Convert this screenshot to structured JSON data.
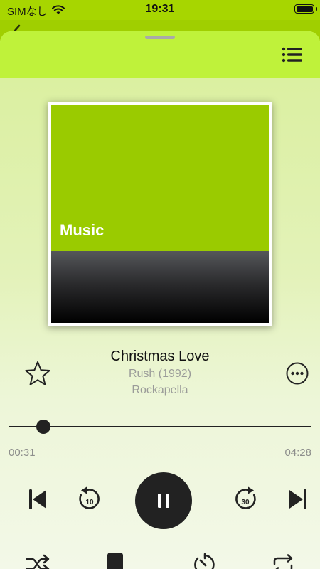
{
  "status_bar": {
    "carrier": "SIMなし",
    "time": "19:31",
    "icons": [
      "wifi-icon",
      "battery-icon"
    ]
  },
  "sheet": {
    "queue_icon": "list-icon"
  },
  "artwork": {
    "label": "Music",
    "top_color": "#9acb00"
  },
  "track": {
    "title": "Christmas Love",
    "album": "Rush (1992)",
    "artist": "Rockapella"
  },
  "progress": {
    "elapsed": "00:31",
    "total": "04:28",
    "fraction": 0.116
  },
  "controls": {
    "skip_back_seconds": "10",
    "skip_forward_seconds": "30",
    "state": "playing",
    "icons": [
      "previous-track-icon",
      "rewind-10-icon",
      "pause-icon",
      "forward-30-icon",
      "next-track-icon",
      "shuffle-icon",
      "airplay-icon",
      "timer-icon",
      "repeat-icon"
    ]
  },
  "colors": {
    "accent": "#bff23a",
    "brand_green": "#9acb00",
    "control_dark": "#222222",
    "secondary_text": "#9a9b99"
  }
}
